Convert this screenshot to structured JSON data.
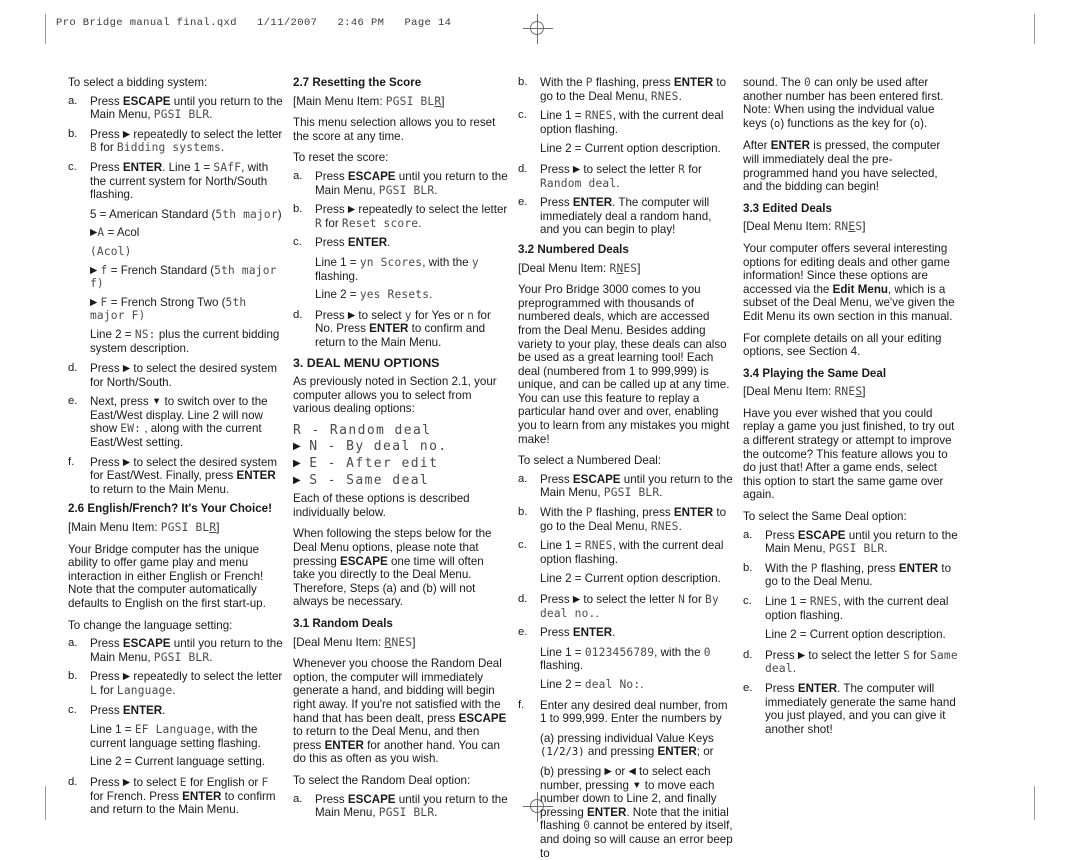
{
  "header": {
    "filename": "Pro Bridge manual final.qxd",
    "date": "1/11/2007",
    "time": "2:46 PM",
    "page_label": "Page 14",
    "line": "Pro Bridge manual final.qxd   1/11/2007   2:46 PM   Page 14"
  },
  "col1": {
    "intro": "To select a bidding system:",
    "step_a_marker": "a.",
    "step_a_l1_pre": "Press ",
    "step_a_l1_key": "ESCAPE",
    "step_a_l1_post": " until you return to the Main Menu, ",
    "step_a_lcd": "PGSI BLR",
    "step_a_end": ".",
    "step_b_marker": "b.",
    "step_b_pre": "Press ",
    "step_b_mid": " repeatedly to select the letter ",
    "step_b_letter": "B",
    "step_b_post": " for ",
    "step_b_lcd": "Bidding  systems",
    "step_b_end": ".",
    "step_c_marker": "c.",
    "step_c_pre": "Press ",
    "step_c_key": "ENTER",
    "step_c_mid": ". Line 1 = ",
    "step_c_lcd": "SAfF",
    "step_c_post": ", with the current system for North/South flashing.",
    "opt_1_pre": "5 = American Standard (",
    "opt_1_lcd": "5th  major",
    "opt_1_post": ")",
    "opt_2_lcd": "A",
    "opt_2_post": " = Acol",
    "opt_3_lcd": "(Acol)",
    "opt_4_lcd": "f",
    "opt_4_post": " = French Standard (",
    "opt_4_lcd2": "5th  major",
    "opt_4_lcd3": "f)",
    "opt_5_lcd": "F",
    "opt_5_post": " = French Strong Two (",
    "opt_5_lcd2": "5th",
    "opt_5_lcd3": "major  F)",
    "line2_pre": "Line 2 = ",
    "line2_lcd": "NS:",
    "line2_post": " plus the current bidding system description.",
    "step_d_marker": "d.",
    "step_d_pre": "Press ",
    "step_d_post": " to select the desired system for North/South.",
    "step_e_marker": "e.",
    "step_e_pre": "Next, press ",
    "step_e_mid": " to switch over to the East/West display. Line 2 will now show ",
    "step_e_lcd": "EW:",
    "step_e_post": " , along with the current East/West setting.",
    "step_f_marker": "f.",
    "step_f_pre": "Press ",
    "step_f_mid": " to select the desired system for East/West. Finally, press ",
    "step_f_key": "ENTER",
    "step_f_post": " to return to the Main Menu.",
    "sec26_head": "2.6 English/French? It's Your Choice!",
    "sec26_menu_pre": "[Main Menu Item: ",
    "sec26_menu_lcd_a": "PGSI BL",
    "sec26_menu_lcd_sel": "R",
    "sec26_menu_post": "]",
    "sec26_body": "Your Bridge computer has the unique ability to offer game play and menu interaction in either English or French! Note that the computer automatically defaults to English on the first start-up.",
    "sec26_intro": "To change the language setting:",
    "l_a_marker": "a.",
    "l_a_pre": "Press ",
    "l_a_key": "ESCAPE",
    "l_a_post": " until you return to the Main Menu, ",
    "l_a_lcd": "PGSI BLR",
    "l_a_end": ".",
    "l_b_marker": "b.",
    "l_b_pre": "Press ",
    "l_b_mid": " repeatedly to select the letter ",
    "l_b_letter": "L",
    "l_b_post": " for ",
    "l_b_lcd": "Language",
    "l_b_end": ".",
    "l_c_marker": "c.",
    "l_c_pre": "Press ",
    "l_c_key": "ENTER",
    "l_c_end": ".",
    "l_c_line1_pre": "Line 1 = ",
    "l_c_line1_lcd": "EF   Language",
    "l_c_line1_post": ", with the current language setting flashing.",
    "l_c_line2": "Line 2 = Current language setting.",
    "l_d_marker": "d.",
    "l_d_pre": "Press ",
    "l_d_mid": " to select ",
    "l_d_lcd1": "E",
    "l_d_mid2": " for English or ",
    "l_d_lcd2": "F",
    "l_d_mid3": " for French. Press ",
    "l_d_key": "ENTER",
    "l_d_post": " to confirm and return to the Main Menu."
  },
  "col2": {
    "sec27_head": "2.7 Resetting the Score",
    "sec27_menu_pre": "[Main Menu Item: ",
    "sec27_menu_lcd_a": "PGSI BL",
    "sec27_menu_lcd_sel": "R",
    "sec27_menu_post": "]",
    "sec27_body": "This menu selection allows you to reset the score at any time.",
    "sec27_intro": "To reset the score:",
    "r_a_marker": "a.",
    "r_a_pre": "Press ",
    "r_a_key": "ESCAPE",
    "r_a_post": " until you return to the Main Menu, ",
    "r_a_lcd": "PGSI BLR",
    "r_a_end": ".",
    "r_b_marker": "b.",
    "r_b_pre": "Press ",
    "r_b_mid": " repeatedly to select the letter ",
    "r_b_letter": "R",
    "r_b_post": " for ",
    "r_b_lcd": "Reset  score",
    "r_b_end": ".",
    "r_c_marker": "c.",
    "r_c_pre": "Press ",
    "r_c_key": "ENTER",
    "r_c_end": ".",
    "r_c_line1_pre": "Line 1 = ",
    "r_c_line1_lcd": "yn  Scores",
    "r_c_line1_mid": ", with the ",
    "r_c_line1_lcd2": "y",
    "r_c_line1_post": " flashing.",
    "r_c_line2_pre": "Line 2 = ",
    "r_c_line2_lcd": "yes  Resets",
    "r_c_line2_post": ".",
    "r_d_marker": "d.",
    "r_d_pre": "Press ",
    "r_d_mid": " to select ",
    "r_d_lcd1": "y",
    "r_d_mid2": " for Yes or ",
    "r_d_lcd2": "n",
    "r_d_mid3": " for No. Press ",
    "r_d_key": "ENTER",
    "r_d_post": " to confirm and return to the Main Menu.",
    "sec3_head": "3. DEAL MENU OPTIONS",
    "sec3_body": "As previously noted in Section 2.1, your computer allows you to select from various dealing options:",
    "opt_r": "R  -  Random  deal",
    "opt_n": "N  -  By  deal  no.",
    "opt_e": "E  -  After  edit",
    "opt_s": "S  -  Same  deal",
    "sec3_each": "Each of these options is described individually below.",
    "sec3_note_pre": "When following the steps below for the Deal Menu options, please note that pressing ",
    "sec3_note_key": "ESCAPE",
    "sec3_note_post": " one time will often take you directly to the Deal Menu. Therefore, Steps (a) and (b) will not always be necessary.",
    "sec31_head": "3.1 Random Deals",
    "sec31_menu_pre": "[Deal Menu Item: ",
    "sec31_menu_lcd_sel": "R",
    "sec31_menu_lcd_b": "NES",
    "sec31_menu_post": "]",
    "sec31_body_1": "Whenever you choose the Random Deal option, the computer will immediately generate a hand, and bidding will begin right away. If you're not satisfied with the hand that has been dealt, press ",
    "sec31_key_1": "ESCAPE",
    "sec31_body_2": " to return to the Deal Menu, and then press ",
    "sec31_key_2": "ENTER",
    "sec31_body_3": " for another hand. You can do this as often as you wish.",
    "sec31_intro": "To select the Random Deal option:",
    "d_a_marker": "a.",
    "d_a_pre": "Press ",
    "d_a_key": "ESCAPE",
    "d_a_post": " until you return to the Main Menu, ",
    "d_a_lcd": "PGSI BLR",
    "d_a_end": "."
  },
  "col3": {
    "d_b_marker": "b.",
    "d_b_pre": "With the ",
    "d_b_lcd": "P",
    "d_b_mid": " flashing, press ",
    "d_b_key": "ENTER",
    "d_b_post": " to go to the Deal Menu, ",
    "d_b_lcd2": "RNES",
    "d_b_end": ".",
    "d_c_marker": "c.",
    "d_c_pre": "Line 1 = ",
    "d_c_lcd": "RNES",
    "d_c_post": ", with the current deal option flashing.",
    "d_c_line2": "Line 2 = Current option description.",
    "d_d_marker": "d.",
    "d_d_pre": "Press ",
    "d_d_mid": " to select the letter ",
    "d_d_letter": "R",
    "d_d_post": " for ",
    "d_d_lcd": "Random  deal",
    "d_d_end": ".",
    "d_e_marker": "e.",
    "d_e_pre": "Press ",
    "d_e_key": "ENTER",
    "d_e_post": ". The computer will immediately deal a random hand, and you can begin to play!",
    "sec32_head": "3.2 Numbered Deals",
    "sec32_menu_pre": "[Deal Menu Item: ",
    "sec32_menu_lcd_a": "R",
    "sec32_menu_lcd_sel": "N",
    "sec32_menu_lcd_b": "ES",
    "sec32_menu_post": "]",
    "sec32_body": "Your Pro Bridge 3000 comes to you preprogrammed with thousands of numbered deals, which are accessed from the Deal Menu. Besides adding variety to your play, these deals can also be used as a great learning tool! Each deal (numbered from 1 to 999,999) is unique, and can be called up at any time. You can use this feature to replay a particular hand over and over, enabling you to learn from any mistakes you might make!",
    "sec32_intro": "To select a Numbered Deal:",
    "n_a_marker": "a.",
    "n_a_pre": "Press ",
    "n_a_key": "ESCAPE",
    "n_a_post": " until you return to the Main Menu, ",
    "n_a_lcd": "PGSI BLR",
    "n_a_end": ".",
    "n_b_marker": "b.",
    "n_b_pre": "With the ",
    "n_b_lcd": "P",
    "n_b_mid": " flashing, press ",
    "n_b_key": "ENTER",
    "n_b_post": " to go to the Deal Menu, ",
    "n_b_lcd2": "RNES",
    "n_b_end": ".",
    "n_c_marker": "c.",
    "n_c_pre": "Line 1 = ",
    "n_c_lcd": "RNES",
    "n_c_post": ", with the current deal option flashing.",
    "n_c_line2": "Line 2 = Current option description.",
    "n_d_marker": "d.",
    "n_d_pre": "Press ",
    "n_d_mid": " to select the letter ",
    "n_d_letter": "N",
    "n_d_post": " for ",
    "n_d_lcd": "By deal  no.",
    "n_d_end": ".",
    "n_e_marker": "e.",
    "n_e_pre": "Press ",
    "n_e_key": "ENTER",
    "n_e_end": ".",
    "n_e_line1_pre": "Line 1 = ",
    "n_e_line1_lcd": "0123456789",
    "n_e_line1_mid": ", with the ",
    "n_e_line1_lcd2": "0",
    "n_e_line1_post": " flashing.",
    "n_e_line2_pre": "Line 2 = ",
    "n_e_line2_lcd": "deal  No:",
    "n_e_line2_post": ".",
    "n_f_marker": "f.",
    "n_f_pre": "Enter any desired deal number, from 1 to 999,999. Enter the numbers by",
    "n_f_a_pre": "(a) pressing individual Value Keys ",
    "n_f_a_code": "(1/2/3)",
    "n_f_a_mid": " and pressing ",
    "n_f_a_key": "ENTER",
    "n_f_a_post": "; or",
    "n_f_b_pre": "(b) pressing ",
    "n_f_b_mid": " or ",
    "n_f_b_mid2": " to select each number, pressing ",
    "n_f_b_mid3": " to move each number down to Line 2, and finally pressing ",
    "n_f_b_key": "ENTER",
    "n_f_b_post": ". Note that the initial flashing ",
    "n_f_b_lcd": "0",
    "n_f_b_post2": " cannot be entered by itself, and doing so will cause an error beep to"
  },
  "col4": {
    "cont_pre": "sound. The ",
    "cont_lcd": "0",
    "cont_mid": " can only be used after another number has been entered first. Note: When using the indvidual value keys (",
    "cont_code1": "o",
    "cont_mid2": ") functions as the key for (",
    "cont_code2": "o",
    "cont_post": ").",
    "after_pre": "After ",
    "after_key": "ENTER",
    "after_post": " is pressed, the computer will immediately deal the pre-programmed hand you have selected, and the bidding can begin!",
    "sec33_head": "3.3 Edited Deals",
    "sec33_menu_pre": "[Deal Menu Item: ",
    "sec33_menu_lcd_a": "RN",
    "sec33_menu_lcd_sel": "E",
    "sec33_menu_lcd_b": "S",
    "sec33_menu_post": "]",
    "sec33_body_pre": "Your computer offers several interesting options for editing deals and other game information! Since these options are accessed via the ",
    "sec33_body_key": "Edit Menu",
    "sec33_body_post": ", which is a subset of the Deal Menu, we've given the Edit Menu its own section in this manual.",
    "sec33_details": "For complete details on all your editing options, see Section 4.",
    "sec34_head": "3.4 Playing the Same Deal",
    "sec34_menu_pre": "[Deal Menu Item: ",
    "sec34_menu_lcd_a": "RNE",
    "sec34_menu_lcd_sel": "S",
    "sec34_menu_post": "]",
    "sec34_body": "Have you ever wished that you could replay a game you just finished, to try out a different strategy or attempt to improve the outcome? This feature allows you to do just that! After a game ends, select this option to start the same game over again.",
    "sec34_intro": "To select the Same Deal option:",
    "s_a_marker": "a.",
    "s_a_pre": "Press ",
    "s_a_key": "ESCAPE",
    "s_a_post": " until you return to the Main Menu, ",
    "s_a_lcd": "PGSI BLR",
    "s_a_end": ".",
    "s_b_marker": "b.",
    "s_b_pre": "With the ",
    "s_b_lcd": "P",
    "s_b_mid": " flashing, press ",
    "s_b_key": "ENTER",
    "s_b_post": " to go to the Deal Menu.",
    "s_c_marker": "c.",
    "s_c_pre": "Line 1 = ",
    "s_c_lcd": "RNES",
    "s_c_post": ", with the current deal option flashing.",
    "s_c_line2": "Line 2 = Current option description.",
    "s_d_marker": "d.",
    "s_d_pre": "Press ",
    "s_d_mid": " to select the letter ",
    "s_d_letter": "S",
    "s_d_post": " for ",
    "s_d_lcd": "Same  deal",
    "s_d_end": ".",
    "s_e_marker": "e.",
    "s_e_pre": "Press ",
    "s_e_key": "ENTER",
    "s_e_post": ". The computer will immediately generate the same hand you just played, and you can give it another shot!"
  }
}
